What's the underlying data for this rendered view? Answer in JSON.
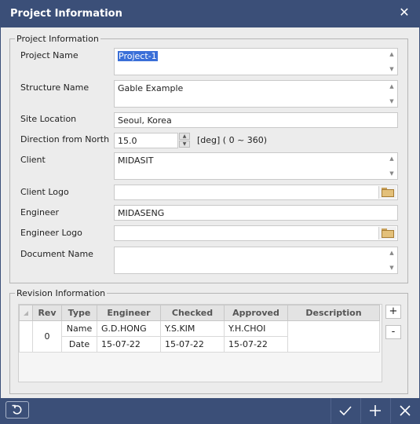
{
  "window": {
    "title": "Project Information"
  },
  "project": {
    "legend": "Project Information",
    "fields": {
      "project_name": {
        "label": "Project Name",
        "value": "Project-1"
      },
      "structure_name": {
        "label": "Structure Name",
        "value": "Gable Example"
      },
      "site_location": {
        "label": "Site Location",
        "value": "Seoul, Korea"
      },
      "direction": {
        "label": "Direction from North",
        "value": "15.0",
        "unit": "[deg] ( 0 ~ 360)"
      },
      "client": {
        "label": "Client",
        "value": "MIDASIT"
      },
      "client_logo": {
        "label": "Client Logo",
        "value": ""
      },
      "engineer": {
        "label": "Engineer",
        "value": "MIDASENG"
      },
      "engineer_logo": {
        "label": "Engineer Logo",
        "value": ""
      },
      "document_name": {
        "label": "Document Name",
        "value": ""
      }
    }
  },
  "revision": {
    "legend": "Revision Information",
    "headers": [
      "Rev",
      "Type",
      "Engineer",
      "Checked",
      "Approved",
      "Description"
    ],
    "rows": [
      {
        "rev": "0",
        "type": "Name",
        "engineer": "G.D.HONG",
        "checked": "Y.S.KIM",
        "approved": "Y.H.CHOI",
        "description": ""
      },
      {
        "rev": "",
        "type": "Date",
        "engineer": "15-07-22",
        "checked": "15-07-22",
        "approved": "15-07-22",
        "description": ""
      }
    ],
    "add_label": "+",
    "remove_label": "-"
  },
  "icons": {
    "close": "close-icon",
    "reset": "reset-icon",
    "confirm": "checkmark-icon",
    "add": "plus-icon",
    "cancel": "close-icon",
    "folder": "folder-icon"
  },
  "colors": {
    "titlebar": "#3b4f78",
    "selection": "#3a6fd8"
  }
}
